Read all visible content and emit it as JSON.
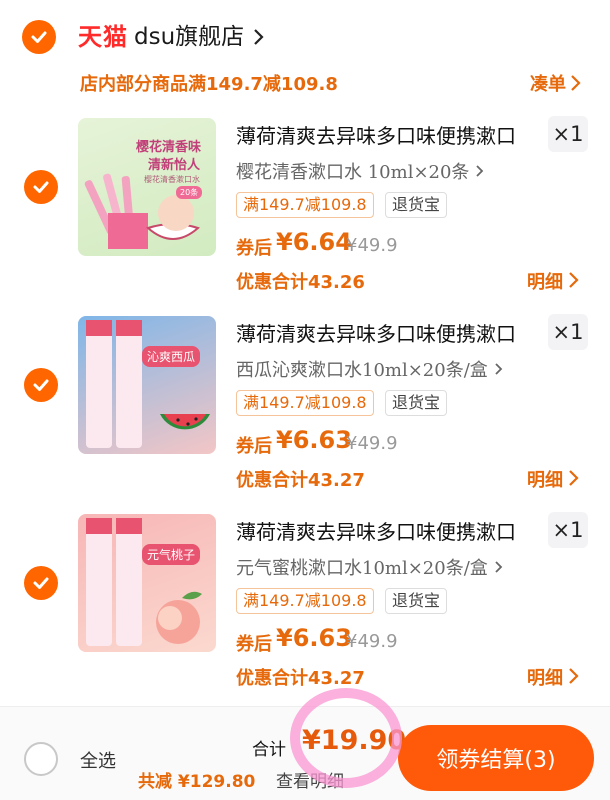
{
  "store": {
    "platform_logo": "天猫",
    "name": "dsu旗舰店",
    "promo": "店内部分商品满149.7减109.8",
    "coudan_label": "凑单"
  },
  "products": [
    {
      "title": "薄荷清爽去异味多口味便携漱口",
      "quantity": "×1",
      "spec": "樱花清香漱口水 10ml×20条",
      "promo_tag": "满149.7减109.8",
      "service_tag": "退货宝",
      "after_coupon_label": "券后",
      "after_coupon_price": "¥6.64",
      "original_price": "¥49.9",
      "discount_total": "优惠合计43.26",
      "detail_label": "明细",
      "thumb": {
        "line1": "樱花清香味",
        "line2": "清新怡人",
        "line3": "樱花清香漱口水",
        "badge": "20条"
      }
    },
    {
      "title": "薄荷清爽去异味多口味便携漱口",
      "quantity": "×1",
      "spec": "西瓜沁爽漱口水10ml×20条/盒",
      "promo_tag": "满149.7减109.8",
      "service_tag": "退货宝",
      "after_coupon_label": "券后",
      "after_coupon_price": "¥6.63",
      "original_price": "¥49.9",
      "discount_total": "优惠合计43.27",
      "detail_label": "明细",
      "thumb": {
        "flavor": "沁爽西瓜"
      }
    },
    {
      "title": "薄荷清爽去异味多口味便携漱口",
      "quantity": "×1",
      "spec": "元气蜜桃漱口水10ml×20条/盒",
      "promo_tag": "满149.7减109.8",
      "service_tag": "退货宝",
      "after_coupon_label": "券后",
      "after_coupon_price": "¥6.63",
      "original_price": "¥49.9",
      "discount_total": "优惠合计43.27",
      "detail_label": "明细",
      "thumb": {
        "flavor": "元气桃子"
      }
    }
  ],
  "bottom": {
    "select_all": "全选",
    "total_label": "合计",
    "total_value": "¥19.90",
    "saved": "共减 ¥129.80",
    "detail_link": "查看明细",
    "checkout": "领券结算(3)"
  },
  "colors": {
    "accent": "#ff6600",
    "promo_text": "#e66a0c",
    "checkout_bg": "#ff5a0a",
    "tmall_red": "#ff2a2a"
  }
}
